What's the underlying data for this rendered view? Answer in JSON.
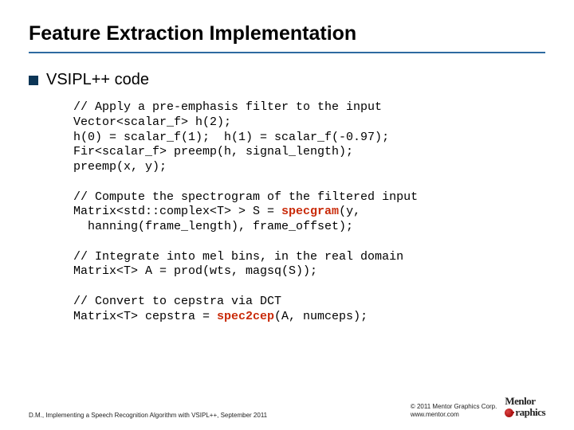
{
  "title": "Feature Extraction Implementation",
  "bullet": "VSIPL++ code",
  "code": {
    "l01": "// Apply a pre-emphasis filter to the input",
    "l02": "Vector<scalar_f> h(2);",
    "l03": "h(0) = scalar_f(1);  h(1) = scalar_f(-0.97);",
    "l04": "Fir<scalar_f> preemp(h, signal_length);",
    "l05": "preemp(x, y);",
    "l06": "",
    "l07": "// Compute the spectrogram of the filtered input",
    "l08a": "Matrix<std::complex<T> > S = ",
    "l08hl": "specgram",
    "l08b": "(y,",
    "l09": "  hanning(frame_length), frame_offset);",
    "l10": "",
    "l11": "// Integrate into mel bins, in the real domain",
    "l12": "Matrix<T> A = prod(wts, magsq(S));",
    "l13": "",
    "l14": "// Convert to cepstra via DCT",
    "l15a": "Matrix<T> cepstra = ",
    "l15hl": "spec2cep",
    "l15b": "(A, numceps);"
  },
  "footer": {
    "left": "D.M., Implementing a Speech Recognition Algorithm with VSIPL++, September 2011",
    "copyright": "© 2011 Mentor Graphics Corp.",
    "url": "www.mentor.com",
    "logo_top": "Menlor",
    "logo_bot": "raphics"
  }
}
